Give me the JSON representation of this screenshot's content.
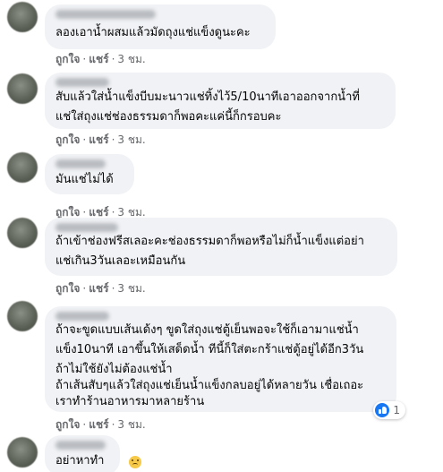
{
  "comments": [
    {
      "lines": [
        "ลองเอาน้ำผสมแล้วมัดถุงแช่แข็งดูนะคะ"
      ],
      "like": "ถูกใจ",
      "reply": "แชร์",
      "time": "3 ชม."
    },
    {
      "lines": [
        "สับแล้วใส่น้ำแข็งบีบมะนาวแช่ทิ้งไว้5/10นาทีเอาออกจากน้ำที่",
        "แช่ใส่ถุงแช่ช่องธรรมดาก็พอคะแค่นี้ก็กรอบคะ"
      ],
      "like": "ถูกใจ",
      "reply": "แชร์",
      "time": "3 ชม."
    },
    {
      "lines": [
        "มันแช่ไม่ได้"
      ],
      "like": "ถูกใจ",
      "reply": "แชร์",
      "time": "3 ชม."
    },
    {
      "lines": [
        "ถ้าเข้าช่องฟรีสเลอะคะช่องธรรมดาก็พอหรือไม่ก็น้ำแข็งแต่อย่า",
        "แช่เกิน3วันเลอะเหมือนกัน"
      ],
      "like": "ถูกใจ",
      "reply": "แชร์",
      "time": "3 ชม."
    },
    {
      "lines": [
        "ถ้าจะขูดแบบเส้นเด้งๆ ขูดใส่ถุงแช่ตู้เย็นพอจะใช้ก็เอามาแช่น้ำ",
        "แข็ง10นาที เอาขึ้นให้เสด็ดน้ำ ทีนี้ก็ใส่ตะกร้าแช่ตู้อยู่ได้อีก3วัน",
        "ถ้าไม่ใช้ยังไม่ต้องแช่น้ำ",
        "ถ้าเส้นสับๆแล้วใส่ถุงแช่เย็นน้ำแข็งกลบอยู่ได้หลายวัน เชื่อเถอะ",
        "เราทำร้านอาหารมาหลายร้าน"
      ],
      "like": "ถูกใจ",
      "reply": "แชร์",
      "time": "3 ชม.",
      "reaction_count": "1"
    },
    {
      "lines": [
        "อย่าหาทำ"
      ],
      "emoji": "confounded-face"
    }
  ],
  "colors": {
    "bubble": "#f0f2f5",
    "text": "#050505",
    "meta": "#65676b",
    "like_blue": "#1877f2"
  }
}
